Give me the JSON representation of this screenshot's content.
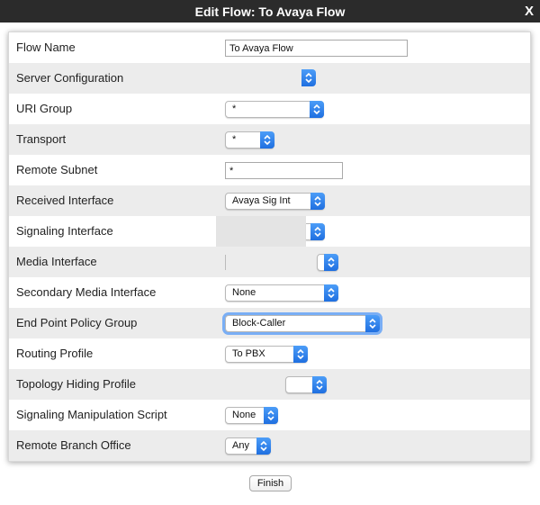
{
  "dialog": {
    "title": "Edit Flow: To Avaya Flow",
    "close_label": "X",
    "finish_label": "Finish"
  },
  "fields": {
    "flow_name": {
      "label": "Flow Name",
      "value": "To Avaya Flow"
    },
    "server_configuration": {
      "label": "Server Configuration",
      "value": ""
    },
    "uri_group": {
      "label": "URI Group",
      "value": "*"
    },
    "transport": {
      "label": "Transport",
      "value": "*"
    },
    "remote_subnet": {
      "label": "Remote Subnet",
      "value": "*"
    },
    "received_interface": {
      "label": "Received Interface",
      "value": "Avaya Sig Int"
    },
    "signaling_interface": {
      "label": "Signaling Interface",
      "value": ""
    },
    "media_interface": {
      "label": "Media Interface",
      "value": ""
    },
    "secondary_media_interface": {
      "label": "Secondary Media Interface",
      "value": "None"
    },
    "end_point_policy_group": {
      "label": "End Point Policy Group",
      "value": "Block-Caller"
    },
    "routing_profile": {
      "label": "Routing Profile",
      "value": "To PBX"
    },
    "topology_hiding_profile": {
      "label": "Topology Hiding Profile",
      "value": ""
    },
    "signaling_manipulation_script": {
      "label": "Signaling Manipulation Script",
      "value": "None"
    },
    "remote_branch_office": {
      "label": "Remote Branch Office",
      "value": "Any"
    }
  },
  "colors": {
    "titlebar": "#2b2b2b",
    "row_alt": "#ececec",
    "select_arrow": "#1f6fe0",
    "focus_ring": "#79aef5"
  }
}
